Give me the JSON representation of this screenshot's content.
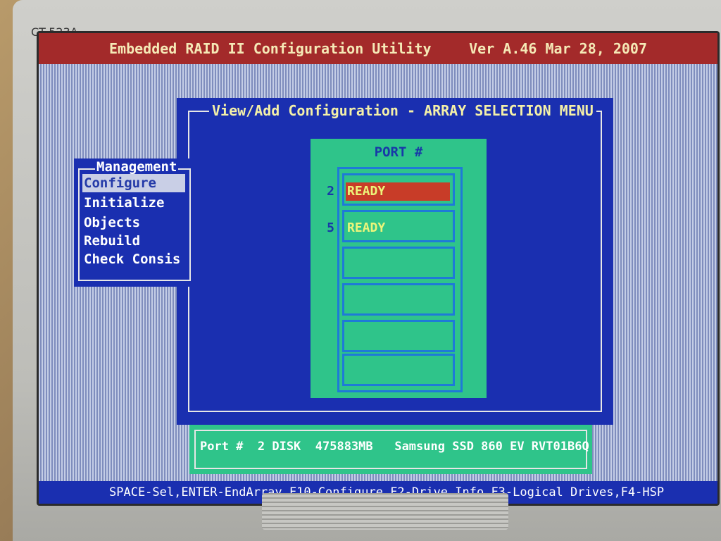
{
  "monitor": {
    "model_label": "CT-523A"
  },
  "header": {
    "app_title": "Embedded RAID II Configuration Utility",
    "version": "Ver A.46 Mar 28, 2007"
  },
  "dialog": {
    "title": "View/Add Configuration - ARRAY SELECTION MENU"
  },
  "port_panel": {
    "title": "PORT #",
    "slots": [
      {
        "number": "2",
        "status": "READY"
      },
      {
        "number": "5",
        "status": "READY"
      },
      {
        "number": "",
        "status": ""
      },
      {
        "number": "",
        "status": ""
      },
      {
        "number": "",
        "status": ""
      },
      {
        "number": "",
        "status": ""
      }
    ]
  },
  "management_menu": {
    "title": "Management",
    "items": [
      "Configure",
      "Initialize",
      "Objects",
      "Rebuild",
      "Check Consis"
    ]
  },
  "info_bar": {
    "text": "Port #  2 DISK  475883MB   Samsung SSD 860 EV RVT01B6Q"
  },
  "key_help": {
    "text": "SPACE-Sel,ENTER-EndArray,F10-Configure,F2-Drive Info,F3-Logical Drives,F4-HSP"
  },
  "colors": {
    "title_bar": "#a32a2a",
    "dialog_bg": "#1a2fb0",
    "panel_green": "#2fc48a",
    "selection_red": "#c83c28",
    "status_yellow": "#ecf57a"
  }
}
